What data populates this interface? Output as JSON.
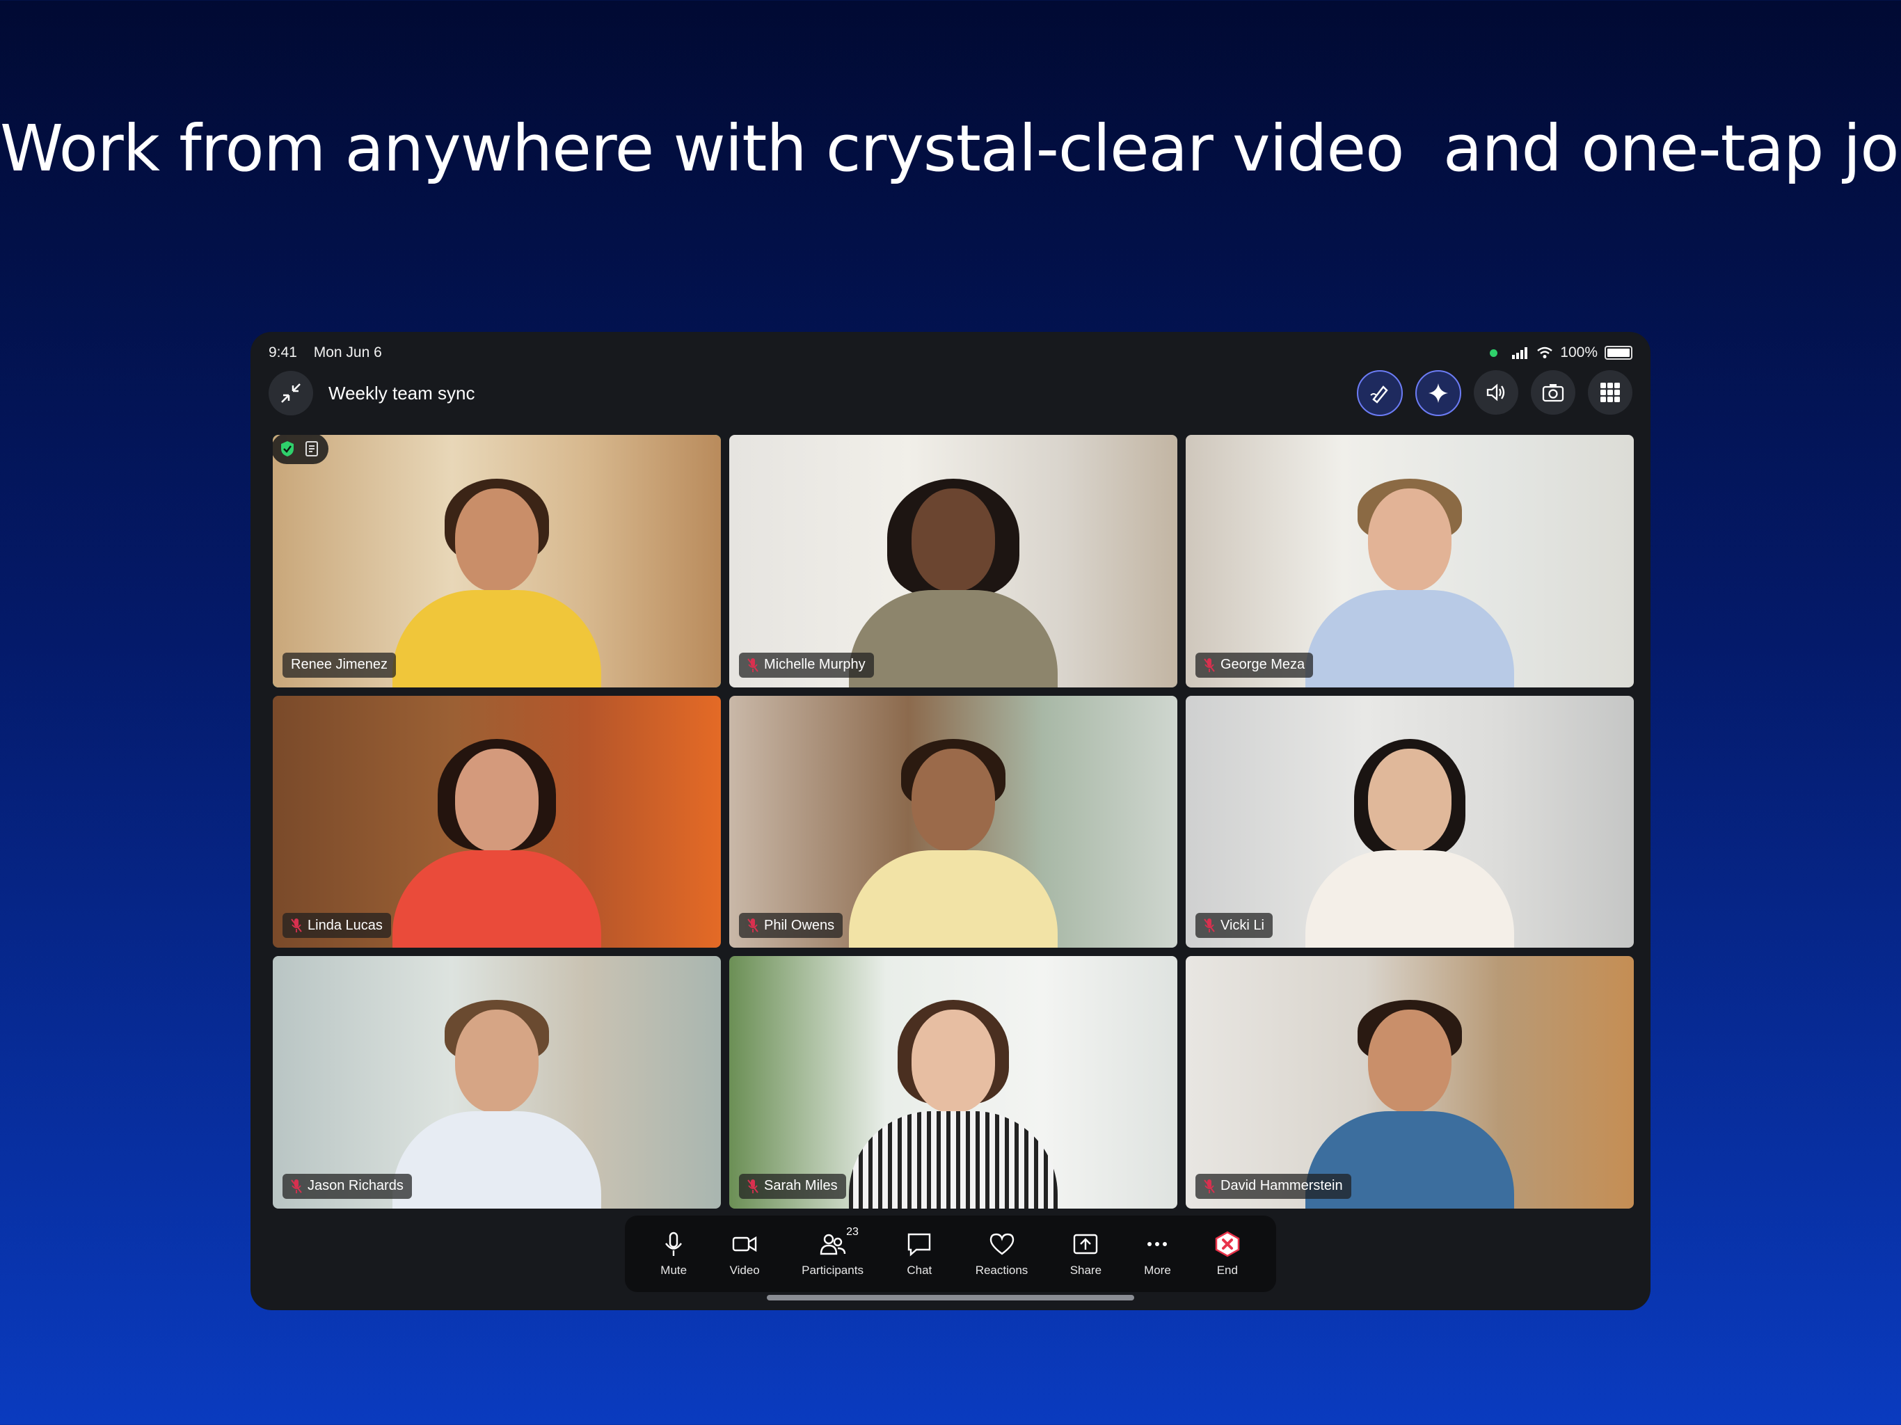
{
  "headline": "Work from anywhere with crystal-clear video  and one-tap join",
  "status": {
    "time": "9:41",
    "date": "Mon Jun 6",
    "battery": "100%"
  },
  "meeting": {
    "title": "Weekly team sync"
  },
  "top_actions": [
    "annotate-icon",
    "ai-assistant-icon",
    "speaker-icon",
    "camera-switch-icon",
    "grid-view-icon"
  ],
  "participants": [
    {
      "name": "Renee Jimenez",
      "muted": false,
      "active": true
    },
    {
      "name": "Michelle Murphy",
      "muted": true
    },
    {
      "name": "George Meza",
      "muted": true
    },
    {
      "name": "Linda Lucas",
      "muted": true
    },
    {
      "name": "Phil Owens",
      "muted": true
    },
    {
      "name": "Vicki Li",
      "muted": true
    },
    {
      "name": "Jason Richards",
      "muted": true
    },
    {
      "name": "Sarah Miles",
      "muted": true
    },
    {
      "name": "David Hammerstein",
      "muted": true
    }
  ],
  "controls": {
    "mute": "Mute",
    "video": "Video",
    "participants": "Participants",
    "participants_count": "23",
    "chat": "Chat",
    "reactions": "Reactions",
    "share": "Share",
    "more": "More",
    "end": "End"
  },
  "colors": {
    "active_speaker": "#2fe39b",
    "end_red": "#e8334a",
    "muted_red": "#d9304f"
  }
}
